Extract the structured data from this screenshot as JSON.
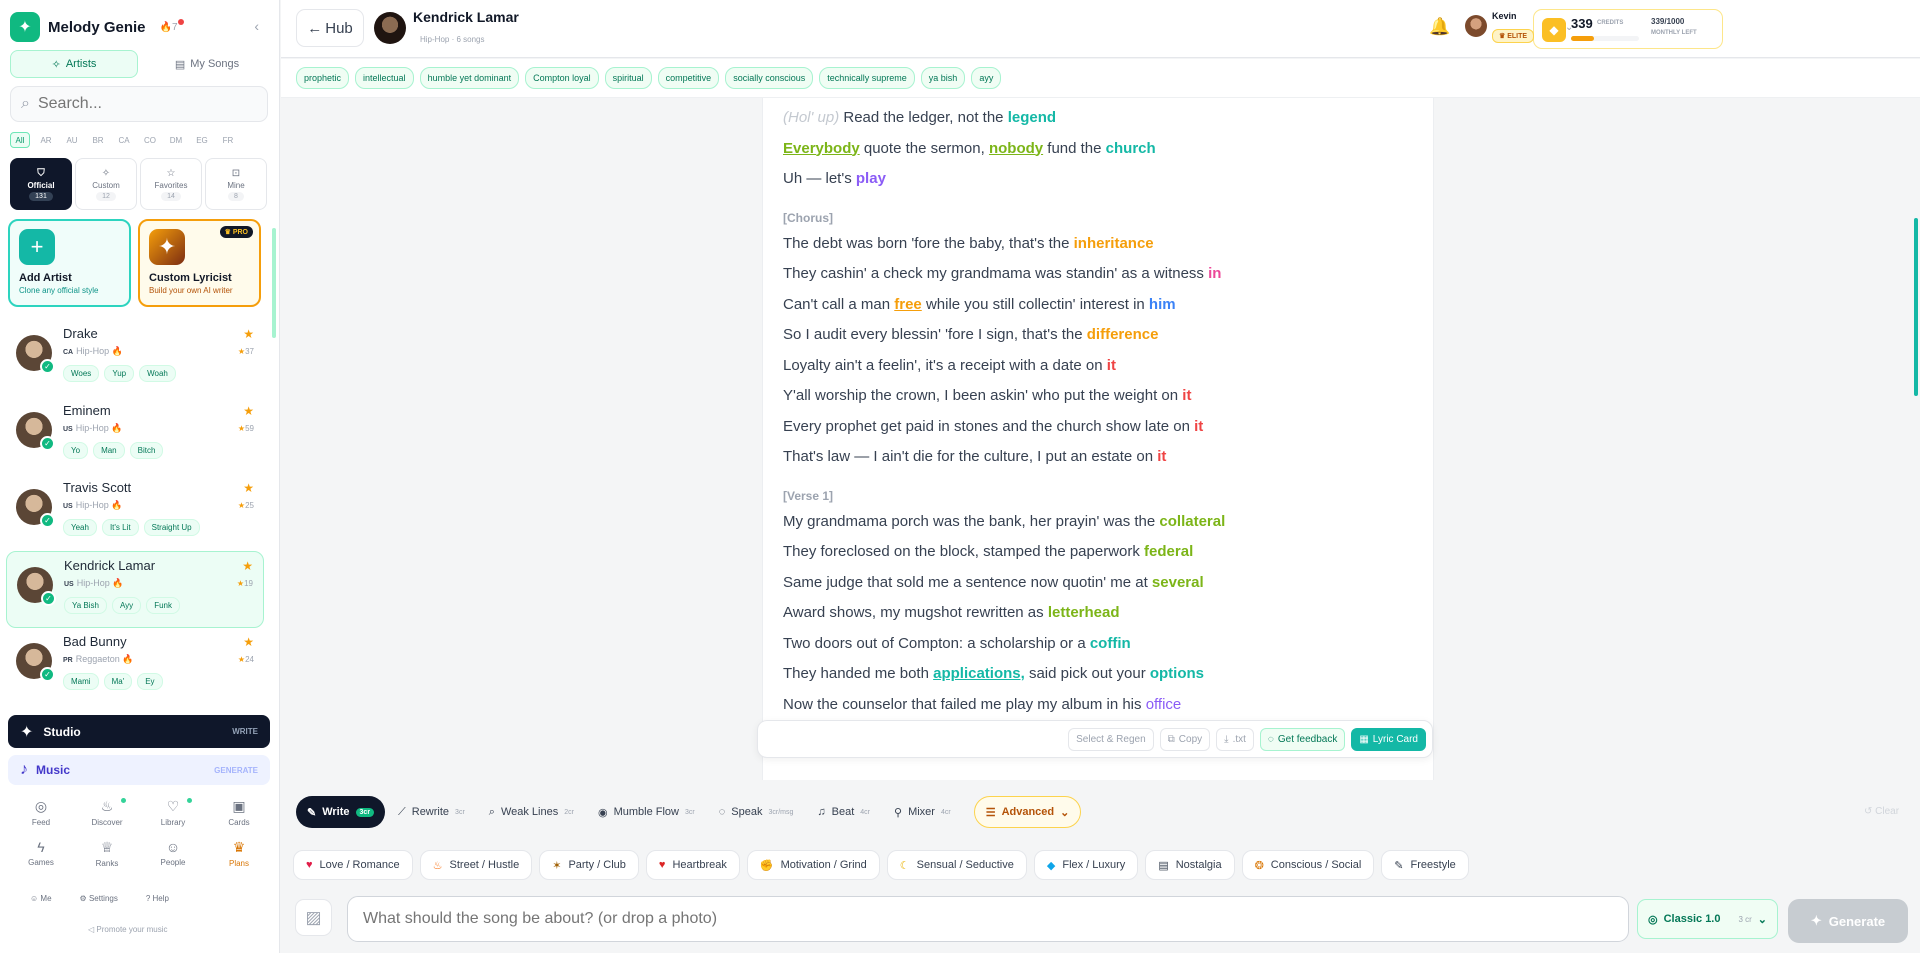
{
  "app": {
    "name": "Melody Genie",
    "streak": "7",
    "search_placeholder": "Search..."
  },
  "sidebar": {
    "tabs": [
      "Artists",
      "My Songs"
    ],
    "countries": [
      "All",
      "AR",
      "AU",
      "BR",
      "CA",
      "CO",
      "DM",
      "EG",
      "FR"
    ],
    "filters": [
      {
        "label": "Official",
        "count": "131"
      },
      {
        "label": "Custom",
        "count": "12"
      },
      {
        "label": "Favorites",
        "count": "14"
      },
      {
        "label": "Mine",
        "count": "8"
      }
    ],
    "add_artist": {
      "title": "Add Artist",
      "sub": "Clone any official style"
    },
    "custom_lyricist": {
      "title": "Custom Lyricist",
      "sub": "Build your own AI writer",
      "badge": "PRO"
    },
    "artists": [
      {
        "name": "Drake",
        "country": "CA",
        "genre": "Hip-Hop",
        "stat": "37",
        "tags": [
          "Woes",
          "Yup",
          "Woah"
        ]
      },
      {
        "name": "Eminem",
        "country": "US",
        "genre": "Hip-Hop",
        "stat": "59",
        "tags": [
          "Yo",
          "Man",
          "Bitch"
        ]
      },
      {
        "name": "Travis Scott",
        "country": "US",
        "genre": "Hip-Hop",
        "stat": "25",
        "tags": [
          "Yeah",
          "It's Lit",
          "Straight Up"
        ]
      },
      {
        "name": "Kendrick Lamar",
        "country": "US",
        "genre": "Hip-Hop",
        "stat": "19",
        "tags": [
          "Ya Bish",
          "Ayy",
          "Funk"
        ]
      },
      {
        "name": "Bad Bunny",
        "country": "PR",
        "genre": "Reggaeton",
        "stat": "24",
        "tags": [
          "Mami",
          "Ma'",
          "Ey"
        ]
      }
    ],
    "studio": {
      "label": "Studio",
      "right": "WRITE"
    },
    "music": {
      "label": "Music",
      "right": "GENERATE"
    },
    "nav": [
      "Feed",
      "Discover",
      "Library",
      "Cards",
      "Games",
      "Ranks",
      "People",
      "Plans"
    ],
    "links": [
      "Me",
      "Settings",
      "Help"
    ],
    "promote": "Promote your music"
  },
  "header": {
    "back": "Hub",
    "artist": "Kendrick Lamar",
    "sub": "Hip-Hop · 6 songs",
    "credits": "339",
    "credits_label": "CREDITS",
    "monthly": "339/1000",
    "monthly_label": "MONTHLY LEFT",
    "credits_fraction": 0.34,
    "user": "Kevin",
    "badge": "ELITE"
  },
  "tags": [
    "prophetic",
    "intellectual",
    "humble yet dominant",
    "Compton loyal",
    "spiritual",
    "competitive",
    "socially conscious",
    "technically supreme",
    "ya bish",
    "ayy"
  ],
  "lyrics": {
    "l1": {
      "note": "(Hol' up)",
      "a": " Read the ledger, not the ",
      "b": "legend"
    },
    "l2": {
      "a": "Everybody",
      "b": " quote the sermon, ",
      "c": "nobody",
      "d": " fund the ",
      "e": "church"
    },
    "l3": {
      "a": "Uh — let's ",
      "b": "play"
    },
    "chorus": "[Chorus]",
    "c1": {
      "a": "The debt was born 'fore the baby, that's the ",
      "b": "inheritance"
    },
    "c2": {
      "a": "They cashin' a check my grandmama was standin' as a witness ",
      "b": "in"
    },
    "c3": {
      "a": "Can't call a man ",
      "b": "free",
      "c": " while you still collectin' interest in ",
      "d": "him"
    },
    "c4": {
      "a": "So I audit every blessin' 'fore I sign, that's the ",
      "b": "difference"
    },
    "c5": {
      "a": "Loyalty ain't a feelin', it's a receipt with a date on ",
      "b": "it"
    },
    "c6": {
      "a": "Y'all worship the crown, I been askin' who put the weight on ",
      "b": "it"
    },
    "c7": {
      "a": "Every prophet get paid in stones and the church show late on ",
      "b": "it"
    },
    "c8": {
      "a": "That's law — I ain't die for the culture, I put an estate on ",
      "b": "it"
    },
    "verse": "[Verse 1]",
    "v1": {
      "a": "My grandmama porch was the bank, her prayin' was the ",
      "b": "collateral"
    },
    "v2": {
      "a": "They foreclosed on the block, stamped the paperwork ",
      "b": "federal"
    },
    "v3": {
      "a": "Same judge that sold me a sentence now quotin' me at ",
      "b": "several"
    },
    "v4": {
      "a": "Award shows, my mugshot rewritten as ",
      "b": "letterhead"
    },
    "v5": {
      "a": "Two doors out of Compton: a scholarship or a ",
      "b": "coffin"
    },
    "v6": {
      "a": "They handed me both ",
      "b": "applications,",
      "c": " said pick out your ",
      "d": "options"
    },
    "v7": {
      "a": "Now the counselor that failed me play my album in his ",
      "b": "office"
    }
  },
  "sheet_toolbar": {
    "regen": "Select & Regen",
    "copy": "Copy",
    "txt": ".txt",
    "feedback": "Get feedback",
    "card": "Lyric Card"
  },
  "modes": [
    {
      "label": "Write",
      "cr": "3cr"
    },
    {
      "label": "Rewrite",
      "cr": "3cr"
    },
    {
      "label": "Weak Lines",
      "cr": "2cr"
    },
    {
      "label": "Mumble Flow",
      "cr": "3cr"
    },
    {
      "label": "Speak",
      "cr": "3cr/msg"
    },
    {
      "label": "Beat",
      "cr": "4cr"
    },
    {
      "label": "Mixer",
      "cr": "4cr"
    },
    {
      "label": "Advanced",
      "cr": ""
    }
  ],
  "clear": "Clear",
  "vibes": [
    "Love / Romance",
    "Street / Hustle",
    "Party / Club",
    "Heartbreak",
    "Motivation / Grind",
    "Sensual / Seductive",
    "Flex / Luxury",
    "Nostalgia",
    "Conscious / Social",
    "Freestyle"
  ],
  "prompt_placeholder": "What should the song be about? (or drop a photo)",
  "model": {
    "label": "Classic 1.0",
    "cr": "3 cr"
  },
  "generate": "Generate"
}
